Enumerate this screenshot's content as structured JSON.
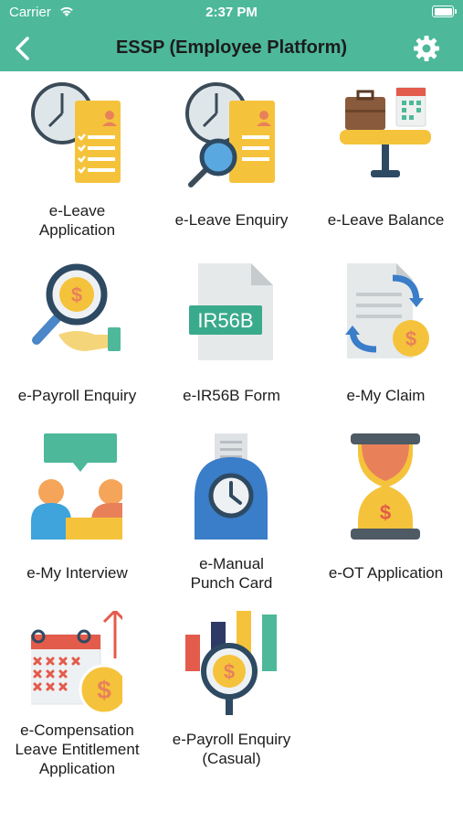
{
  "status": {
    "carrier": "Carrier",
    "time": "2:37 PM"
  },
  "header": {
    "title": "ESSP (Employee Platform)"
  },
  "menu": [
    {
      "label": "e-Leave\nApplication",
      "icon": "leave-application-icon"
    },
    {
      "label": "e-Leave Enquiry",
      "icon": "leave-enquiry-icon"
    },
    {
      "label": "e-Leave Balance",
      "icon": "leave-balance-icon"
    },
    {
      "label": "e-Payroll Enquiry",
      "icon": "payroll-enquiry-icon"
    },
    {
      "label": "e-IR56B Form",
      "icon": "ir56b-form-icon"
    },
    {
      "label": "e-My Claim",
      "icon": "my-claim-icon"
    },
    {
      "label": "e-My Interview",
      "icon": "my-interview-icon"
    },
    {
      "label": "e-Manual\nPunch Card",
      "icon": "punch-card-icon"
    },
    {
      "label": "e-OT Application",
      "icon": "ot-application-icon"
    },
    {
      "label": "e-Compensation\nLeave Entitlement\nApplication",
      "icon": "compensation-leave-icon"
    },
    {
      "label": "e-Payroll Enquiry\n(Casual)",
      "icon": "payroll-casual-icon"
    }
  ],
  "icon_texts": {
    "ir56b": "IR56B",
    "currency": "$"
  },
  "colors": {
    "accent": "#4db89a",
    "gold": "#f5c33b",
    "navy": "#2e4a62",
    "red": "#e35b4b"
  }
}
